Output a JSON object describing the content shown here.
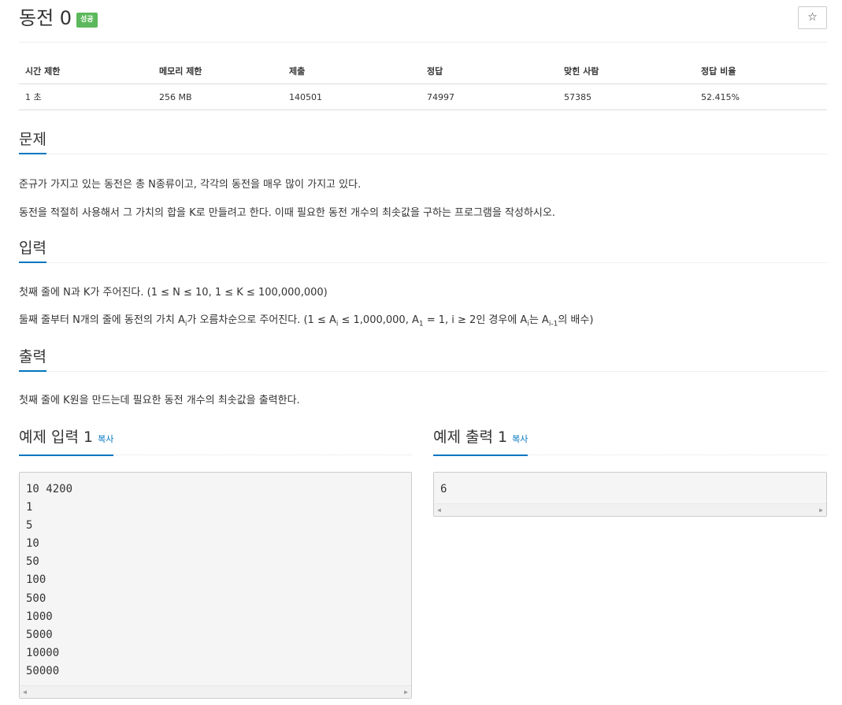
{
  "header": {
    "title": "동전 0",
    "badge": "성공",
    "star_icon": "☆"
  },
  "stats": {
    "headers": [
      "시간 제한",
      "메모리 제한",
      "제출",
      "정답",
      "맞힌 사람",
      "정답 비율"
    ],
    "values": [
      "1 초",
      "256 MB",
      "140501",
      "74997",
      "57385",
      "52.415%"
    ]
  },
  "problem": {
    "heading": "문제",
    "p1": "준규가 가지고 있는 동전은 총 N종류이고, 각각의 동전을 매우 많이 가지고 있다.",
    "p2": "동전을 적절히 사용해서 그 가치의 합을 K로 만들려고 한다. 이때 필요한 동전 개수의 최솟값을 구하는 프로그램을 작성하시오."
  },
  "input": {
    "heading": "입력",
    "p1": "첫째 줄에 N과 K가 주어진다. (1 ≤ N ≤ 10, 1 ≤ K ≤ 100,000,000)",
    "p2_a": "둘째 줄부터 N개의 줄에 동전의 가치 A",
    "p2_sub1": "i",
    "p2_b": "가 오름차순으로 주어진다. (1 ≤ A",
    "p2_sub2": "i",
    "p2_c": " ≤ 1,000,000, A",
    "p2_sub3": "1",
    "p2_d": " = 1, i ≥ 2인 경우에 A",
    "p2_sub4": "i",
    "p2_e": "는 A",
    "p2_sub5": "i-1",
    "p2_f": "의 배수)"
  },
  "output": {
    "heading": "출력",
    "p1": "첫째 줄에 K원을 만드는데 필요한 동전 개수의 최솟값을 출력한다."
  },
  "samples": {
    "input_title": "예제 입력 1",
    "output_title": "예제 출력 1",
    "copy_label": "복사",
    "input_lines": [
      "10 4200",
      "1",
      "5",
      "10",
      "50",
      "100",
      "500",
      "1000",
      "5000",
      "10000",
      "50000"
    ],
    "output_lines": [
      "6"
    ]
  }
}
